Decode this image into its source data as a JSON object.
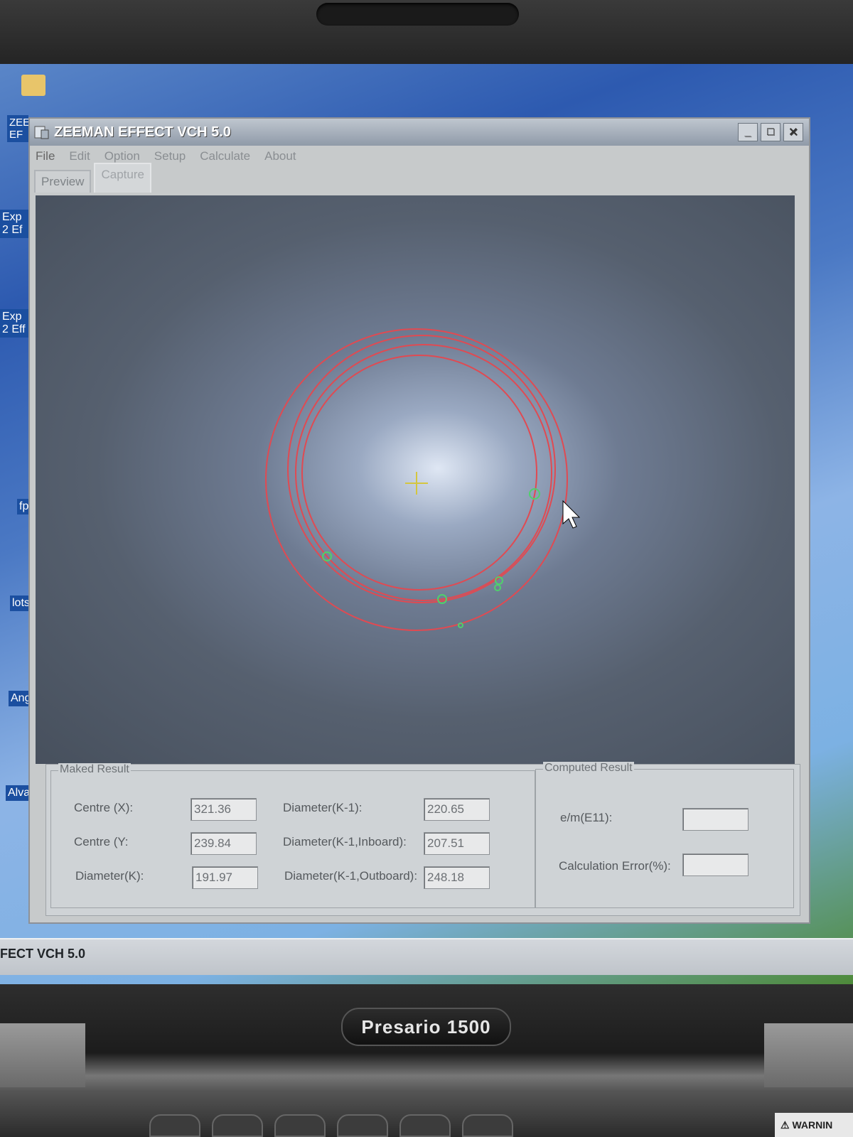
{
  "window": {
    "title": "ZEEMAN EFFECT VCH 5.0",
    "controls": [
      "_",
      "□",
      "✕"
    ]
  },
  "menu": [
    "File",
    "Edit",
    "Option",
    "Setup",
    "Calculate",
    "About"
  ],
  "tabs": [
    {
      "label": "Preview",
      "active": false
    },
    {
      "label": "Capture",
      "active": true
    }
  ],
  "maked_result": {
    "label": "Maked Result",
    "centre_x": {
      "label": "Centre (X):",
      "value": "321.36"
    },
    "centre_y": {
      "label": "Centre (Y:",
      "value": "239.84"
    },
    "diameter_k": {
      "label": "Diameter(K):",
      "value": "191.97"
    },
    "diameter_k1": {
      "label": "Diameter(K-1):",
      "value": "220.65"
    },
    "diameter_k1_inboard": {
      "label": "Diameter(K-1,Inboard):",
      "value": "207.51"
    },
    "diameter_k1_outboard": {
      "label": "Diameter(K-1,Outboard):",
      "value": "248.18"
    }
  },
  "computed_result": {
    "label": "Computed Result",
    "em": {
      "label": "e/m(E11):",
      "value": ""
    },
    "error": {
      "label": "Calculation Error(%):",
      "value": ""
    }
  },
  "taskbar": {
    "item": "FECT VCH 5.0"
  },
  "desktop_icons": [
    "ZEEMAN EF",
    "Exp 2 Ef",
    "Exp 2 Eff",
    "fp",
    "lots",
    "Angl",
    "Alvar"
  ],
  "laptop": {
    "brand": "Presario 1500",
    "warning": "⚠ WARNIN"
  },
  "colors": {
    "ring": "#e04a52",
    "marker": "#4fd16b",
    "crosshair": "#d4c640"
  }
}
